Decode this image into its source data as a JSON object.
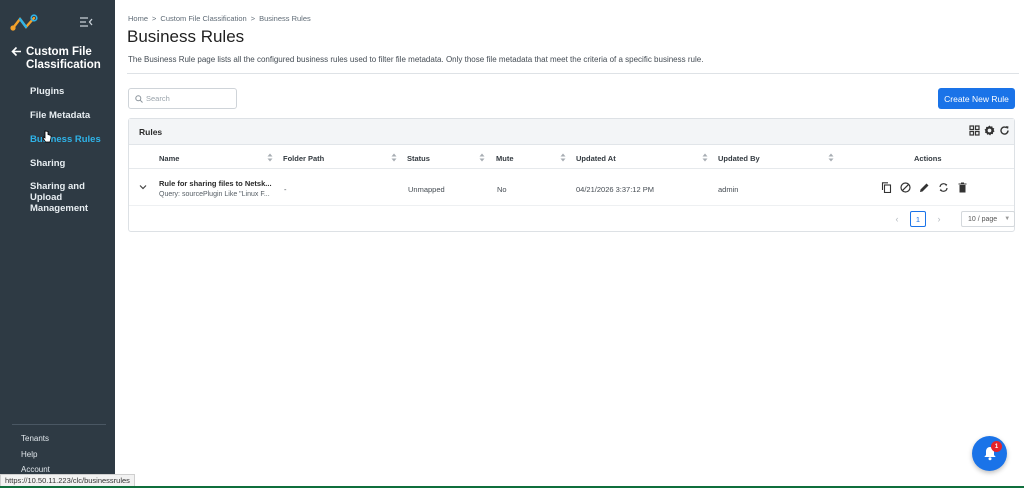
{
  "sidebar": {
    "section_title": "Custom File Classification",
    "items": [
      {
        "label": "Plugins"
      },
      {
        "label": "File Metadata"
      },
      {
        "label": "Business Rules"
      },
      {
        "label": "Sharing"
      },
      {
        "label": "Sharing and Upload Management"
      }
    ],
    "bottom_links": [
      {
        "label": "Tenants"
      },
      {
        "label": "Help"
      },
      {
        "label": "Account"
      }
    ]
  },
  "breadcrumb": {
    "items": [
      "Home",
      "Custom File Classification",
      "Business Rules"
    ],
    "separator": ">"
  },
  "page": {
    "title": "Business Rules",
    "description": "The Business Rule page lists all the configured business rules used to filter file metadata. Only those file metadata that meet the criteria of a specific business rule."
  },
  "search": {
    "placeholder": "Search"
  },
  "toolbar": {
    "create_label": "Create New Rule"
  },
  "card": {
    "title": "Rules"
  },
  "table": {
    "columns": [
      "Name",
      "Folder Path",
      "Status",
      "Mute",
      "Updated At",
      "Updated By",
      "Actions"
    ],
    "rows": [
      {
        "name": "Rule for sharing files to Netsk...",
        "query": "Query: sourcePlugin Like \"Linux F...",
        "folder_path": "-",
        "status": "Unmapped",
        "mute": "No",
        "updated_at": "04/21/2026 3:37:12 PM",
        "updated_by": "admin"
      }
    ]
  },
  "pagination": {
    "current_page": "1",
    "page_size": "10 / page"
  },
  "notification": {
    "count": "1"
  },
  "statusbar": {
    "url": "https://10.50.11.223/clc/businessrules"
  },
  "colors": {
    "sidebar_bg": "#2e3a44",
    "accent": "#1a73e8",
    "active_nav": "#2fb3e8",
    "badge": "#e5242b"
  }
}
